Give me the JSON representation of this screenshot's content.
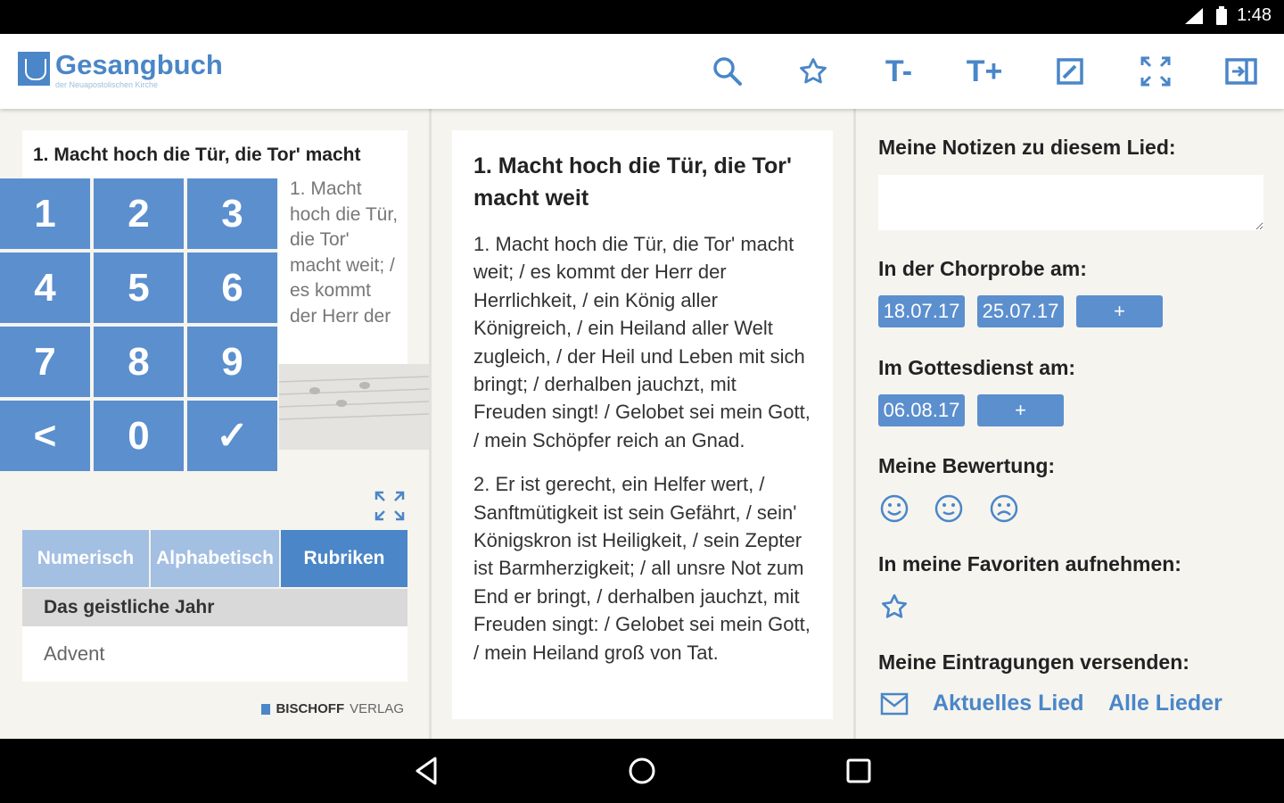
{
  "status": {
    "time": "1:48"
  },
  "app": {
    "title": "Gesangbuch",
    "subtitle": "der Neuapostolischen Kirche"
  },
  "toolbar": {
    "font_smaller": "T-",
    "font_larger": "T+"
  },
  "song_preview": {
    "title": "1. Macht hoch die Tür, die Tor' macht",
    "text": "1. Macht hoch die Tür, die Tor' macht weit; / es kommt der Herr der"
  },
  "keypad": {
    "keys": [
      "1",
      "2",
      "3",
      "4",
      "5",
      "6",
      "7",
      "8",
      "9",
      "<",
      "0",
      "✓"
    ]
  },
  "tabs": [
    {
      "label": "Numerisch",
      "active": false
    },
    {
      "label": "Alphabetisch",
      "active": false
    },
    {
      "label": "Rubriken",
      "active": true
    }
  ],
  "category": {
    "header": "Das geistliche Jahr",
    "item": "Advent"
  },
  "publisher": {
    "bold": "BISCHOFF",
    "light": "VERLAG"
  },
  "lyrics": {
    "title": "1. Macht hoch die Tür, die Tor' macht weit",
    "verses": [
      "1. Macht hoch die Tür, die Tor' macht weit; / es kommt der Herr der Herrlichkeit, / ein König aller Königreich, / ein Heiland aller Welt zugleich, / der Heil und Leben mit sich bringt; / derhalben jauchzt, mit Freuden singt! / Gelobet sei mein Gott, / mein Schöpfer reich an Gnad.",
      "2. Er ist gerecht, ein Helfer wert, / Sanftmütigkeit ist sein Gefährt, / sein' Königskron ist Heiligkeit, / sein Zepter ist Barmherzigkeit; / all unsre Not zum End er bringt, / derhalben jauchzt, mit Freuden singt: / Gelobet sei mein Gott, / mein Heiland groß von Tat."
    ]
  },
  "notes": {
    "notes_heading": "Meine Notizen zu diesem Lied:",
    "notes_value": "",
    "choir_heading": "In der Chorprobe am:",
    "choir_dates": [
      "18.07.17",
      "25.07.17"
    ],
    "add_label": "+",
    "service_heading": "Im Gottesdienst am:",
    "service_dates": [
      "06.08.17"
    ],
    "rating_heading": "Meine Bewertung:",
    "favorites_heading": "In meine Favoriten aufnehmen:",
    "send_heading": "Meine Eintragungen versenden:",
    "send_current": "Aktuelles Lied",
    "send_all": "Alle Lieder"
  },
  "colors": {
    "accent": "#4a86c8",
    "key": "#5b8fce",
    "tab_inactive": "#a3bfe2",
    "panel": "#f6f4ef"
  }
}
